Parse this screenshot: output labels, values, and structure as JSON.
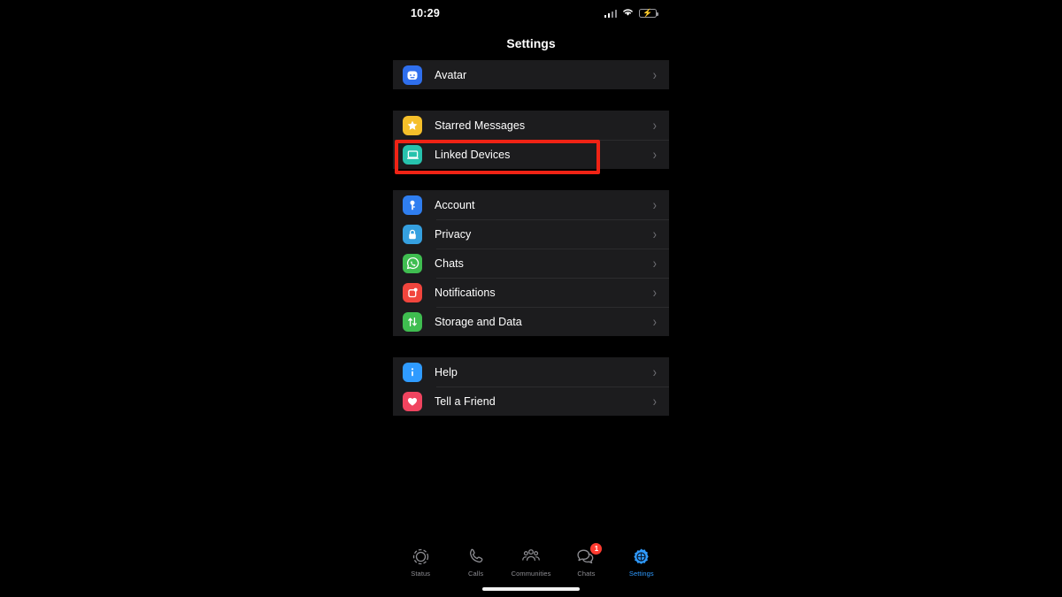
{
  "status_bar": {
    "time": "10:29",
    "signal_icon": "cellular-signal-icon",
    "wifi_icon": "wifi-icon",
    "battery_icon": "battery-charging-icon",
    "battery_color": "#32d24d"
  },
  "nav": {
    "title": "Settings"
  },
  "highlight": {
    "color": "#f02315",
    "target_row": "Linked Devices"
  },
  "groups": [
    {
      "id": "profile",
      "rows": [
        {
          "label": "Avatar",
          "icon": "avatar-icon",
          "color": "#2f6fed",
          "chevron": "›"
        }
      ]
    },
    {
      "id": "shortcuts",
      "rows": [
        {
          "label": "Starred Messages",
          "icon": "star-icon",
          "color": "#f5bf2a",
          "chevron": "›"
        },
        {
          "label": "Linked Devices",
          "icon": "laptop-icon",
          "color": "#27c2ad",
          "chevron": "›"
        }
      ]
    },
    {
      "id": "preferences",
      "rows": [
        {
          "label": "Account",
          "icon": "key-icon",
          "color": "#2f7ef0",
          "chevron": "›"
        },
        {
          "label": "Privacy",
          "icon": "lock-icon",
          "color": "#35a0e0",
          "chevron": "›"
        },
        {
          "label": "Chats",
          "icon": "whatsapp-chat-icon",
          "color": "#3fbd50",
          "chevron": "›"
        },
        {
          "label": "Notifications",
          "icon": "notification-icon",
          "color": "#f1453d",
          "chevron": "›"
        },
        {
          "label": "Storage and Data",
          "icon": "arrows-updown-icon",
          "color": "#3fbd50",
          "chevron": "›"
        }
      ]
    },
    {
      "id": "support",
      "rows": [
        {
          "label": "Help",
          "icon": "info-icon",
          "color": "#2f9bff",
          "chevron": "›"
        },
        {
          "label": "Tell a Friend",
          "icon": "heart-icon",
          "color": "#f0445f",
          "chevron": "›"
        }
      ]
    }
  ],
  "tabbar": {
    "items": [
      {
        "label": "Status",
        "icon": "status-rings-icon",
        "active": false,
        "badge": ""
      },
      {
        "label": "Calls",
        "icon": "phone-icon",
        "active": false,
        "badge": ""
      },
      {
        "label": "Communities",
        "icon": "communities-icon",
        "active": false,
        "badge": ""
      },
      {
        "label": "Chats",
        "icon": "chat-bubbles-icon",
        "active": false,
        "badge": "1"
      },
      {
        "label": "Settings",
        "icon": "gear-icon",
        "active": true,
        "badge": ""
      }
    ],
    "active_color": "#2f9bff",
    "inactive_color": "#8e8e93",
    "badge_color": "#ff3b30"
  }
}
